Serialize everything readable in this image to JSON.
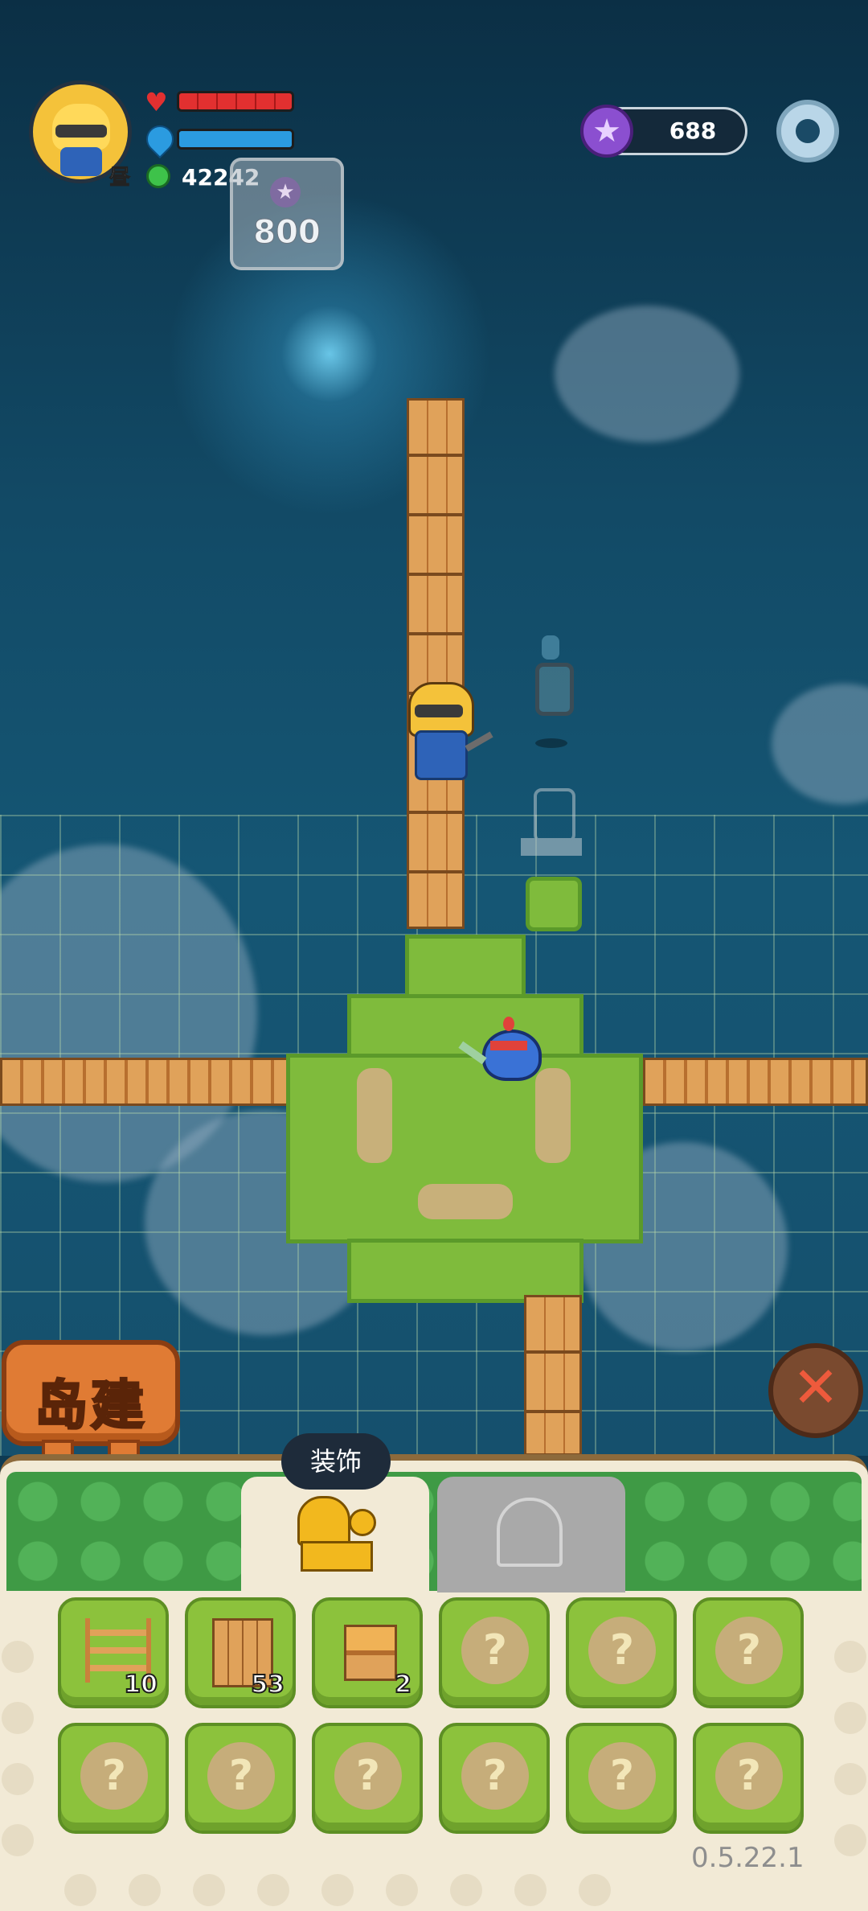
{
  "hud": {
    "gold_amount": "42242",
    "price_tag": "800",
    "gem_amount": "688",
    "day_label": "昼"
  },
  "icons": {
    "health": "heart-icon",
    "mana": "mana-drop-icon",
    "gold": "green-coin-icon",
    "gem": "purple-star-gem-icon",
    "settings": "gear-icon",
    "close": "close-icon",
    "unknown": "question-mark-icon"
  },
  "buttons": {
    "build_label": "岛建",
    "close_label": "✕"
  },
  "tabs": {
    "decoration_tooltip": "装饰",
    "decoration_icon": "decoration-icon",
    "other_icon": "blueprint-icon"
  },
  "inventory": {
    "slots": [
      {
        "item": "ladder",
        "count": "10"
      },
      {
        "item": "wood-planks",
        "count": "53"
      },
      {
        "item": "wood-block",
        "count": "2"
      },
      {
        "item": "locked",
        "count": ""
      },
      {
        "item": "locked",
        "count": ""
      },
      {
        "item": "locked",
        "count": ""
      },
      {
        "item": "locked",
        "count": ""
      },
      {
        "item": "locked",
        "count": ""
      },
      {
        "item": "locked",
        "count": ""
      },
      {
        "item": "locked",
        "count": ""
      },
      {
        "item": "locked",
        "count": ""
      },
      {
        "item": "locked",
        "count": ""
      }
    ],
    "unknown_glyph": "?"
  },
  "version": "0.5.22.1",
  "colors": {
    "health": "#e23030",
    "mana": "#2b9be0",
    "grass": "#7fbb3c",
    "plank": "#d28e48",
    "accent_orange": "#e07b34"
  }
}
